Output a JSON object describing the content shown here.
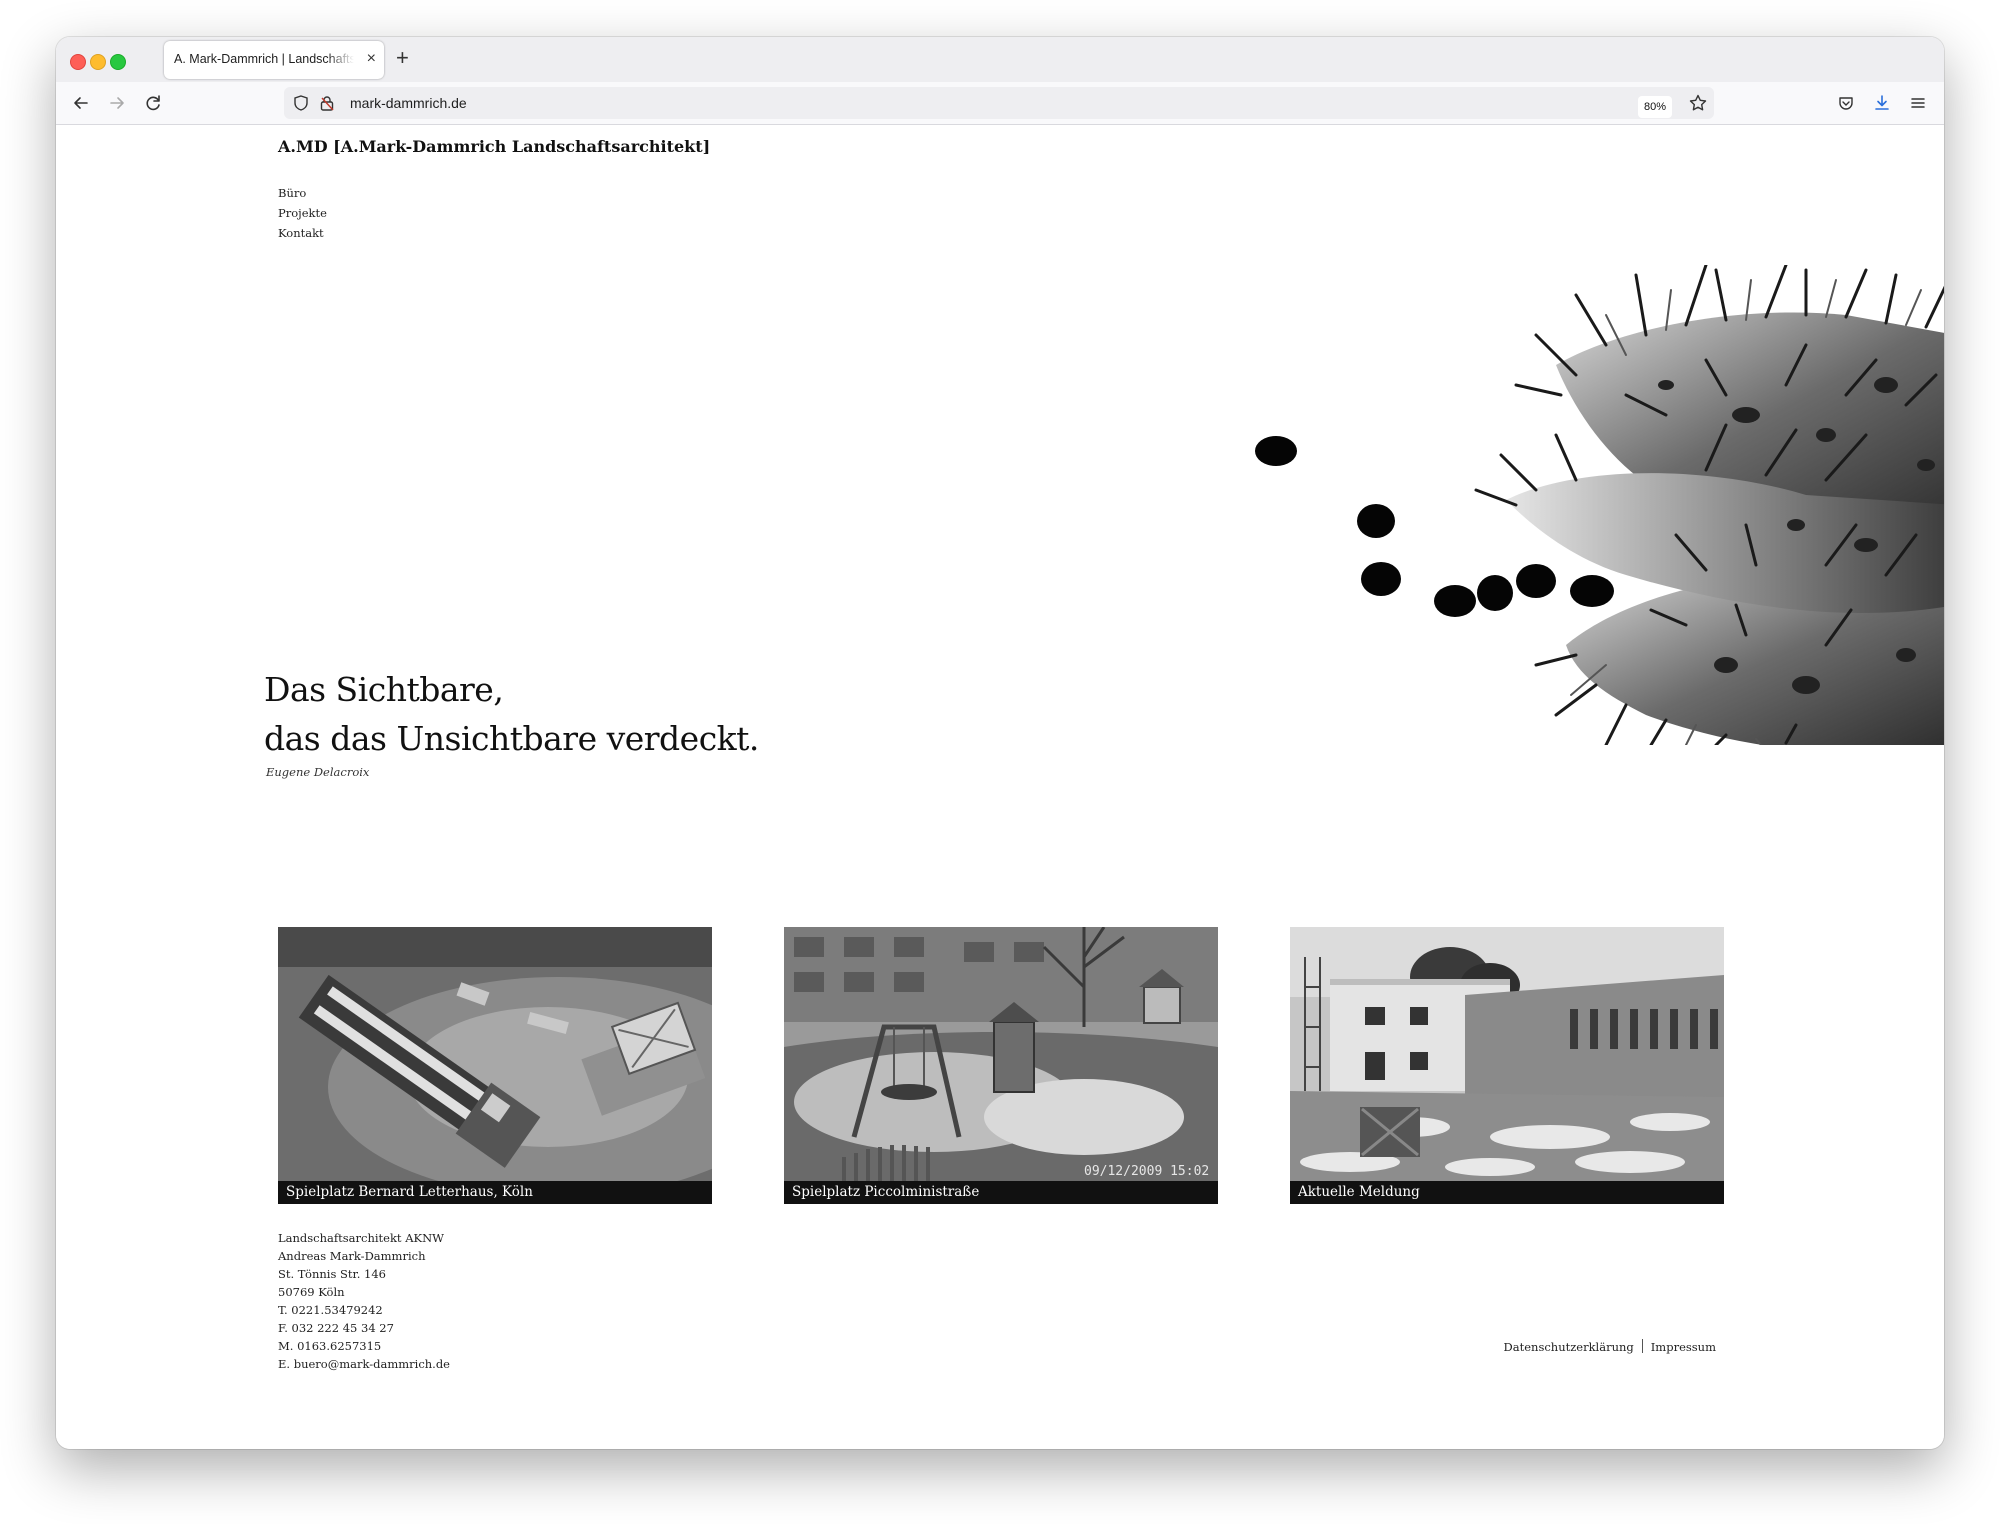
{
  "browser": {
    "tab_title": "A. Mark-Dammrich | Landschaftsarchitekt",
    "url": "mark-dammrich.de",
    "zoom": "80%"
  },
  "site": {
    "brand_abbr": "A.MD",
    "brand_full": "[A.Mark-Dammrich Landschaftsarchitekt]",
    "menu": [
      "Büro",
      "Projekte",
      "Kontakt"
    ],
    "quote_line1": "Das Sichtbare,",
    "quote_line2": "das das Unsichtbare verdeckt.",
    "quote_author": "Eugene Delacroix",
    "projects": [
      {
        "caption": "Spielplatz Bernard Letterhaus, Köln"
      },
      {
        "caption": "Spielplatz Piccolministraße",
        "photo_timestamp": "09/12/2009 15:02"
      },
      {
        "caption": "Aktuelle Meldung"
      }
    ],
    "footer": {
      "address_lines": [
        "Landschaftsarchitekt AKNW",
        "Andreas Mark-Dammrich",
        "St. Tönnis Str. 146",
        "50769 Köln",
        "T. 0221.53479242",
        "F. 032 222 45 34 27",
        "M. 0163.6257315",
        "E. buero@mark-dammrich.de"
      ],
      "privacy": "Datenschutzerklärung",
      "imprint": "Impressum"
    }
  }
}
